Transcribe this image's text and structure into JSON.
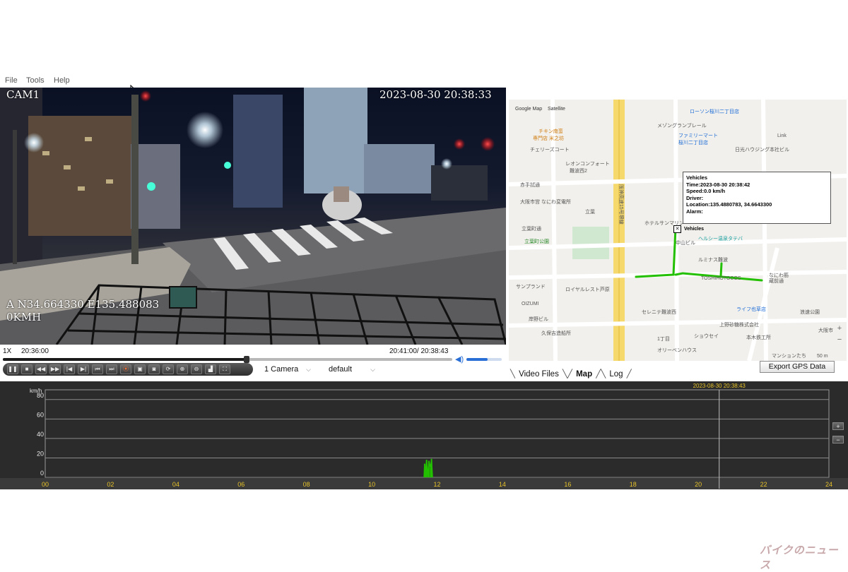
{
  "menu": {
    "file": "File",
    "tools": "Tools",
    "help": "Help"
  },
  "video": {
    "camera": "CAM1",
    "datetime": "2023-08-30 20:38:33",
    "gps": "A N34.664330 E135.488083",
    "speed": "0KMH"
  },
  "playback": {
    "rate": "1X",
    "start_time": "20:36:00",
    "end_current": "20:41:00/ 20:38:43",
    "progress": 0.542,
    "volume": 0.6,
    "control_icons": [
      "play-icon",
      "stop-icon",
      "rewind-icon",
      "fast-forward-icon",
      "frame-back-icon",
      "frame-forward-icon",
      "skip-start-icon",
      "skip-end-icon",
      "record-icon",
      "clip-icon",
      "snapshot-icon",
      "loop-icon",
      "zoom-in-icon",
      "zoom-out-icon",
      "chart-icon",
      "fullscreen-icon"
    ],
    "camera_select": "1 Camera",
    "profile_select": "default"
  },
  "map": {
    "map_types": [
      "Google Map",
      "Satellite"
    ],
    "vehicle_info": {
      "title": "Vehicles",
      "time": "Time:2023-08-30 20:38:42",
      "speed": "Speed:0.0 km/h",
      "driver": "Driver:",
      "location": "Location:135.4880783, 34.6643300",
      "alarm": "Alarm:"
    },
    "marker_label": "Vehicles",
    "labels": [
      "ローソン桜川二丁目店",
      "メゾングランブレール",
      "ファミリーマート",
      "桜川二丁目店",
      "チキン南蛮",
      "専門店 米之坊",
      "チェリーズコート",
      "レオンコンフォート",
      "難波西2",
      "赤手拭通",
      "大阪市営 なにわ変電所",
      "立葉",
      "立葉町通",
      "立葉町公園",
      "ホテルサンマリン",
      "中山ビル",
      "ヘルシー温泉タテバ",
      "ルミナス難波",
      "サンプランド",
      "ロイヤルレスト芦原",
      "OIZUMI",
      "岸野ビル",
      "久保吉造船所",
      "セレニテ難波西",
      "ライフ也草店",
      "上野砂糖株式会社",
      "オリーベンハウス",
      "マンションたち",
      "なにわ筋",
      "蔵前通",
      "浪速公園",
      "大阪市",
      "Link",
      "阪神高速15号堺線",
      "本木鉄工所",
      "日光ハウジング本社ビル",
      "ショウセイ",
      "1丁目",
      "TOSHIHOTOCOS"
    ],
    "scale": "50 m"
  },
  "tabs": [
    "Video Files",
    "Map",
    "Log"
  ],
  "export_button": "Export GPS Data",
  "speed_graph": {
    "unit": "km/h",
    "y_ticks": [
      "0",
      "20",
      "40",
      "60",
      "80"
    ],
    "x_ticks": [
      "00",
      "02",
      "04",
      "06",
      "08",
      "10",
      "12",
      "14",
      "16",
      "18",
      "20",
      "22",
      "24"
    ],
    "cursor_label": "2023-08-30 20:38:43",
    "cursor_hour": 20.64,
    "activity_hour_range": [
      11.55,
      11.9
    ],
    "buttons": [
      "+",
      "−"
    ]
  },
  "chart_data": {
    "type": "line",
    "title": "",
    "xlabel": "",
    "ylabel": "km/h",
    "xlim": [
      0,
      24
    ],
    "ylim": [
      0,
      90
    ],
    "series": [
      {
        "x": [
          11.6,
          11.62,
          11.65,
          11.68,
          11.72,
          11.75,
          11.8,
          11.83,
          11.86
        ],
        "values": [
          0,
          14,
          6,
          18,
          0,
          17,
          10,
          19,
          0
        ]
      }
    ]
  },
  "watermark": "バイクのニュース",
  "colors": {
    "track": "#22c000",
    "graph_bg": "#2b2b2b",
    "cursor_label": "#e6c229",
    "accent": "#2a6fd6"
  }
}
